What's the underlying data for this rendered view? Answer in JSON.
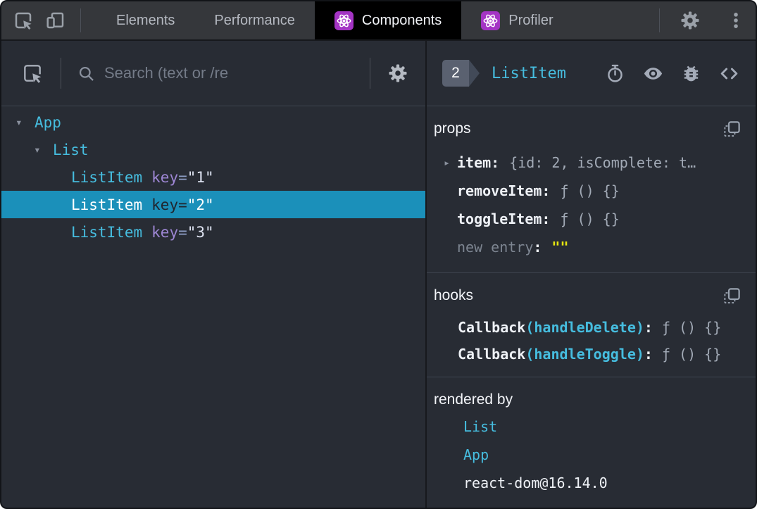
{
  "topbar": {
    "tabs": [
      {
        "id": "elements",
        "label": "Elements",
        "active": false,
        "icon": null
      },
      {
        "id": "performance",
        "label": "Performance",
        "active": false,
        "icon": null
      },
      {
        "id": "components",
        "label": "Components",
        "active": true,
        "icon": "react-logo"
      },
      {
        "id": "profiler",
        "label": "Profiler",
        "active": false,
        "icon": "react-logo"
      }
    ]
  },
  "left_panel": {
    "search": {
      "placeholder": "Search (text or /re"
    },
    "tree": [
      {
        "name": "App",
        "depth": 0,
        "expanded": true,
        "selected": false,
        "key": null
      },
      {
        "name": "List",
        "depth": 1,
        "expanded": true,
        "selected": false,
        "key": null
      },
      {
        "name": "ListItem",
        "depth": 2,
        "expanded": false,
        "selected": false,
        "key": "1"
      },
      {
        "name": "ListItem",
        "depth": 2,
        "expanded": false,
        "selected": true,
        "key": "2"
      },
      {
        "name": "ListItem",
        "depth": 2,
        "expanded": false,
        "selected": false,
        "key": "3"
      }
    ]
  },
  "right_panel": {
    "selected_index_badge": "2",
    "component_name": "ListItem",
    "sections": {
      "props": {
        "title": "props",
        "rows": [
          {
            "key": "item",
            "value": "{id: 2, isComplete: t…",
            "expandable": true,
            "value_type": "preview"
          },
          {
            "key": "removeItem",
            "value": "ƒ () {}",
            "expandable": false,
            "value_type": "function"
          },
          {
            "key": "toggleItem",
            "value": "ƒ () {}",
            "expandable": false,
            "value_type": "function"
          },
          {
            "key": "new entry",
            "value": "\"\"",
            "expandable": false,
            "value_type": "editable-string"
          }
        ]
      },
      "hooks": {
        "title": "hooks",
        "rows": [
          {
            "hook": "Callback",
            "name": "handleDelete",
            "value": "ƒ () {}"
          },
          {
            "hook": "Callback",
            "name": "handleToggle",
            "value": "ƒ () {}"
          }
        ]
      },
      "rendered_by": {
        "title": "rendered by",
        "items": [
          {
            "label": "List",
            "link": true
          },
          {
            "label": "App",
            "link": true
          },
          {
            "label": "react-dom@16.14.0",
            "link": false
          }
        ]
      }
    }
  },
  "colors": {
    "accent_component": "#46bddf",
    "selected_row_bg": "#1b90ba",
    "key_attr_purple": "#9d86d3",
    "editable_value_yellow": "#e5e510",
    "react_icon_purple": "#a434c4",
    "panel_bg": "#282c34",
    "topbar_bg": "#35373b"
  }
}
